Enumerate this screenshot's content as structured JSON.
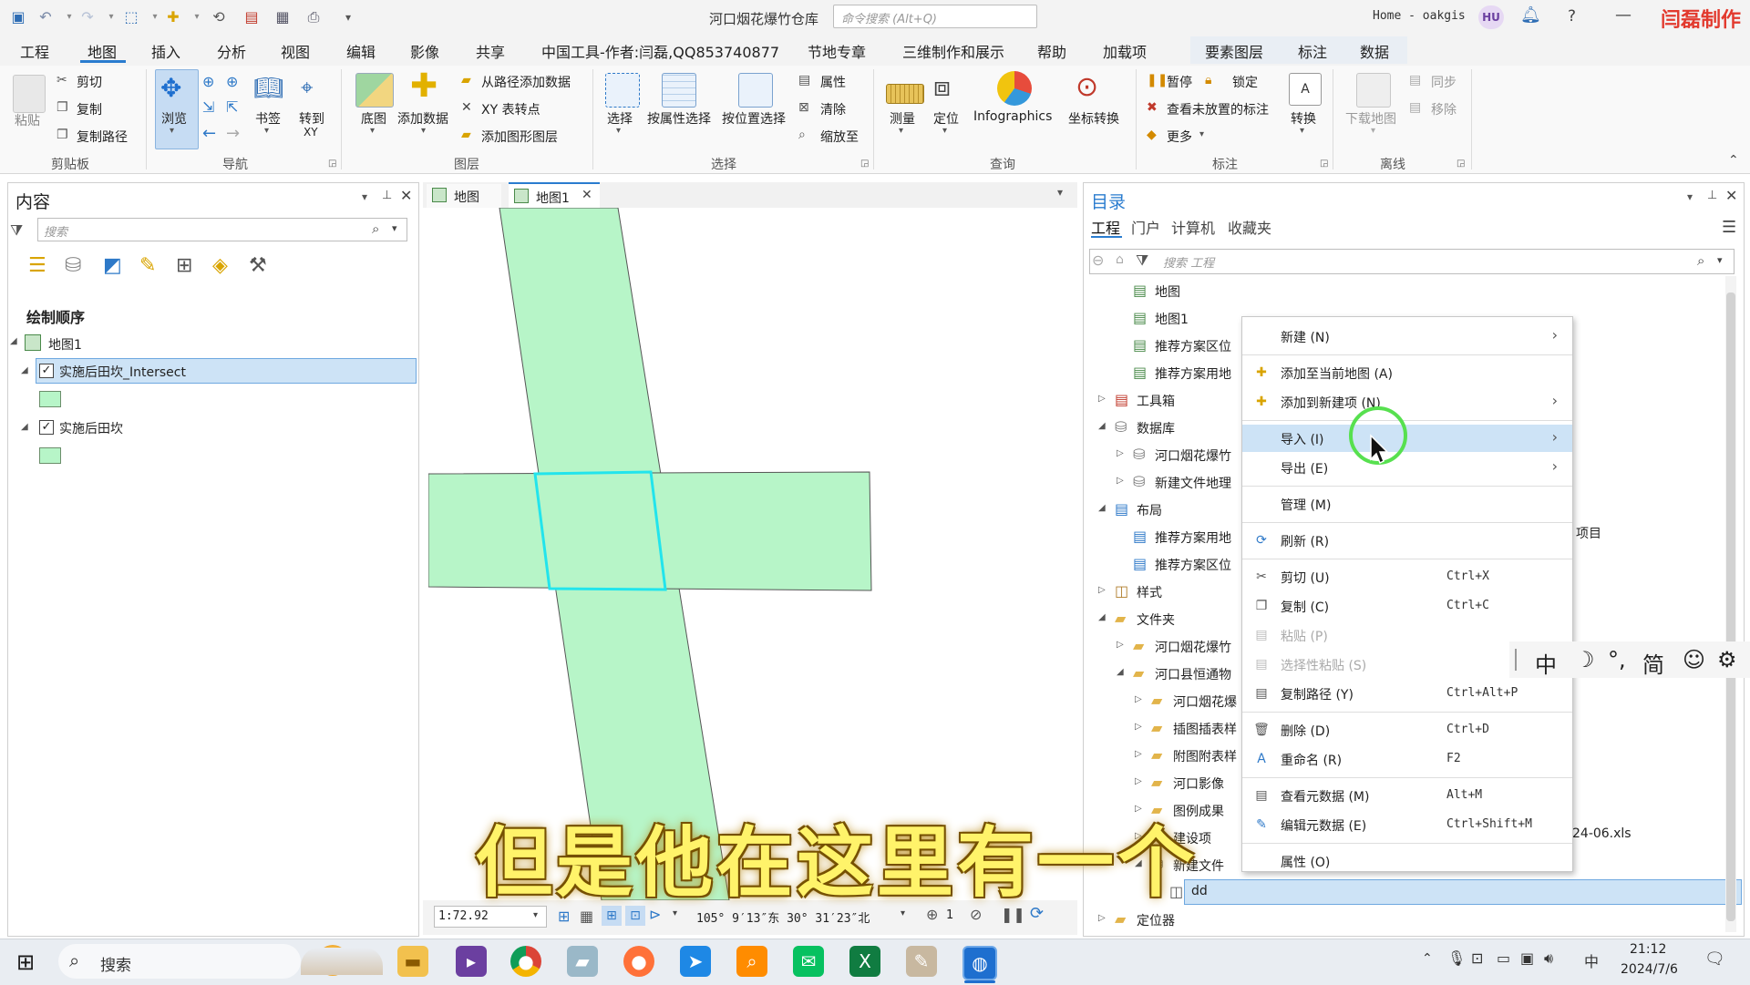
{
  "titlebar": {
    "title": "河口烟花爆竹仓库",
    "command_search_placeholder": "命令搜索 (Alt+Q)",
    "user": "Home - oakgis",
    "avatar": "HU",
    "brand": "闫磊制作"
  },
  "menu": {
    "tabs": [
      "工程",
      "地图",
      "插入",
      "分析",
      "视图",
      "编辑",
      "影像",
      "共享",
      "中国工具-作者:闫磊,QQ853740877",
      "节地专章",
      "三维制作和展示",
      "帮助",
      "加载项"
    ],
    "active": "地图",
    "context_tabs": [
      "要素图层",
      "标注",
      "数据"
    ]
  },
  "ribbon": {
    "clipboard": {
      "paste": "粘贴",
      "cut": "剪切",
      "copy": "复制",
      "copy_path": "复制路径",
      "group": "剪贴板"
    },
    "navigate": {
      "explore": "浏览",
      "bookmarks": "书签",
      "goto_xy": "转到",
      "goto_xy2": "XY",
      "group": "导航"
    },
    "layer": {
      "basemap": "底图",
      "add_data": "添加数据",
      "add_from_path": "从路径添加数据",
      "xy_table": "XY 表转点",
      "add_graphics": "添加图形图层",
      "group": "图层"
    },
    "selection": {
      "select": "选择",
      "by_attr": "按属性选择",
      "by_location": "按位置选择",
      "attributes": "属性",
      "clear": "清除",
      "zoom_to": "缩放至",
      "group": "选择"
    },
    "inquiry": {
      "measure": "测量",
      "locate": "定位",
      "infographics": "Infographics",
      "coord_convert": "坐标转换",
      "group": "查询"
    },
    "labeling": {
      "pause": "暂停",
      "lock": "锁定",
      "unplaced": "查看未放置的标注",
      "more": "更多",
      "convert": "转换",
      "group": "标注"
    },
    "offline": {
      "download": "下载地图",
      "sync": "同步",
      "remove": "移除",
      "group": "离线"
    }
  },
  "contents": {
    "title": "内容",
    "search_placeholder": "搜索",
    "section": "绘制顺序",
    "map": "地图1",
    "layers": [
      {
        "name": "实施后田坎_Intersect",
        "checked": true,
        "selected": true,
        "color": "#b7f5c8"
      },
      {
        "name": "实施后田坎",
        "checked": true,
        "selected": false,
        "color": "#b7f5c8"
      }
    ]
  },
  "map_view": {
    "tabs": [
      "地图",
      "地图1"
    ],
    "active_tab": "地图1",
    "scale": "1:72.92",
    "coordinates": "105° 9′13″东 30° 31′23″北",
    "selected_count": "1",
    "fill_color": "#b7f5c8",
    "highlight_color": "#22e4ec"
  },
  "catalog": {
    "title": "目录",
    "tabs": [
      "工程",
      "门户",
      "计算机",
      "收藏夹"
    ],
    "active_tab": "工程",
    "search_placeholder": "搜索 工程",
    "items": [
      {
        "label": "地图",
        "indent": 2,
        "icon": "map"
      },
      {
        "label": "地图1",
        "indent": 2,
        "icon": "map"
      },
      {
        "label": "推荐方案区位",
        "indent": 2,
        "icon": "map"
      },
      {
        "label": "推荐方案用地",
        "indent": 2,
        "icon": "map"
      },
      {
        "label": "工具箱",
        "indent": 1,
        "icon": "toolbox",
        "expander": "▷"
      },
      {
        "label": "数据库",
        "indent": 1,
        "icon": "db",
        "expander": "◢"
      },
      {
        "label": "河口烟花爆竹",
        "indent": 2,
        "icon": "gdb",
        "expander": "▷"
      },
      {
        "label": "新建文件地理",
        "indent": 2,
        "icon": "db",
        "expander": "▷"
      },
      {
        "label": "布局",
        "indent": 1,
        "icon": "layout",
        "expander": "◢"
      },
      {
        "label": "推荐方案用地",
        "indent": 2,
        "icon": "layout"
      },
      {
        "label": "推荐方案区位",
        "indent": 2,
        "icon": "layout"
      },
      {
        "label": "样式",
        "indent": 1,
        "icon": "style",
        "expander": "▷"
      },
      {
        "label": "文件夹",
        "indent": 1,
        "icon": "folder",
        "expander": "◢"
      },
      {
        "label": "河口烟花爆竹",
        "indent": 2,
        "icon": "folderhome",
        "expander": "▷"
      },
      {
        "label": "河口县恒通物",
        "indent": 2,
        "icon": "folder",
        "expander": "◢"
      },
      {
        "label": "河口烟花爆",
        "indent": 3,
        "icon": "folderhome",
        "expander": "▷"
      },
      {
        "label": "插图插表样",
        "indent": 3,
        "icon": "folder",
        "expander": "▷"
      },
      {
        "label": "附图附表样",
        "indent": 3,
        "icon": "folder",
        "expander": "▷"
      },
      {
        "label": "河口影像",
        "indent": 3,
        "icon": "folder",
        "expander": "▷"
      },
      {
        "label": "图例成果",
        "indent": 3,
        "icon": "folder",
        "expander": "▷"
      },
      {
        "label": "建设项",
        "indent": 3,
        "icon": "folder",
        "expander": "▷"
      },
      {
        "label": "新建文件",
        "indent": 3,
        "icon": "db",
        "expander": "◢"
      },
      {
        "label": "dd",
        "indent": 4,
        "icon": "fds",
        "expander": "▷",
        "selected": true
      },
      {
        "label": "定位器",
        "indent": 1,
        "icon": "locator",
        "expander": "▷"
      }
    ],
    "partial_right_texts": [
      "项目",
      "24-06.xls"
    ]
  },
  "context_menu": {
    "items": [
      {
        "label": "新建 (N)",
        "icon": "",
        "shortcut": "",
        "submenu": true
      },
      {
        "sep": true
      },
      {
        "label": "添加至当前地图 (A)",
        "icon": "add",
        "shortcut": ""
      },
      {
        "label": "添加到新建项 (N)",
        "icon": "add",
        "shortcut": "",
        "submenu": true
      },
      {
        "sep": true
      },
      {
        "label": "导入 (I)",
        "icon": "",
        "shortcut": "",
        "submenu": true,
        "highlight": true
      },
      {
        "label": "导出 (E)",
        "icon": "",
        "shortcut": "",
        "submenu": true
      },
      {
        "sep": true
      },
      {
        "label": "管理 (M)",
        "icon": "",
        "shortcut": ""
      },
      {
        "sep": true
      },
      {
        "label": "刷新 (R)",
        "icon": "refresh",
        "shortcut": ""
      },
      {
        "sep": true
      },
      {
        "label": "剪切 (U)",
        "icon": "cut",
        "shortcut": "Ctrl+X"
      },
      {
        "label": "复制 (C)",
        "icon": "copy",
        "shortcut": "Ctrl+C"
      },
      {
        "label": "粘贴 (P)",
        "icon": "paste",
        "shortcut": "",
        "disabled": true
      },
      {
        "label": "选择性粘贴 (S)",
        "icon": "paste",
        "shortcut": "",
        "disabled": true
      },
      {
        "label": "复制路径 (Y)",
        "icon": "copypath",
        "shortcut": "Ctrl+Alt+P"
      },
      {
        "sep": true
      },
      {
        "label": "删除 (D)",
        "icon": "delete",
        "shortcut": "Ctrl+D"
      },
      {
        "label": "重命名 (R)",
        "icon": "rename",
        "shortcut": "F2"
      },
      {
        "sep": true
      },
      {
        "label": "查看元数据 (M)",
        "icon": "meta",
        "shortcut": "Alt+M"
      },
      {
        "label": "编辑元数据 (E)",
        "icon": "editmeta",
        "shortcut": "Ctrl+Shift+M"
      },
      {
        "sep": true
      },
      {
        "label": "属性 (O)",
        "icon": "",
        "shortcut": ""
      }
    ]
  },
  "ime": {
    "items": [
      "中",
      "☽",
      "°,",
      "简",
      "☺",
      "⚙"
    ]
  },
  "subtitle": "但是他在这里有一个",
  "taskbar": {
    "search": "搜索",
    "time": "21:12",
    "date": "2024/7/6",
    "ime": "中"
  }
}
